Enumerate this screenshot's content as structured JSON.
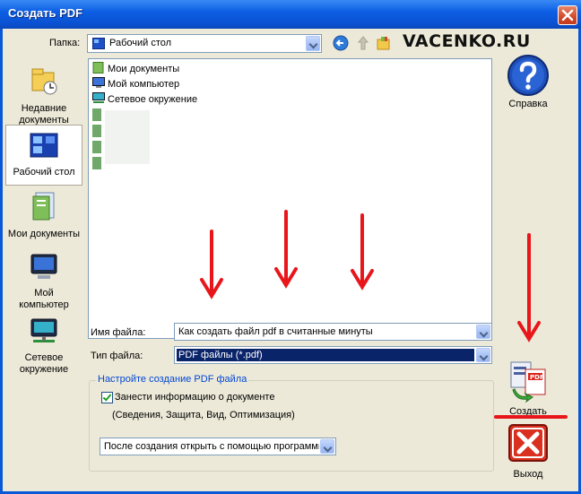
{
  "window": {
    "title": "Создать PDF"
  },
  "watermark": "VACENKO.RU",
  "folder": {
    "label": "Папка:",
    "value": "Рабочий стол"
  },
  "places": [
    {
      "label": "Недавние документы",
      "icon": "recent-documents-icon"
    },
    {
      "label": "Рабочий стол",
      "icon": "desktop-icon",
      "selected": true
    },
    {
      "label": "Мои документы",
      "icon": "my-documents-icon"
    },
    {
      "label": "Мой компьютер",
      "icon": "my-computer-icon"
    },
    {
      "label": "Сетевое окружение",
      "icon": "network-places-icon"
    }
  ],
  "files": [
    {
      "name": "Мои документы",
      "icon": "my-documents-icon"
    },
    {
      "name": "Мой компьютер",
      "icon": "my-computer-icon"
    },
    {
      "name": "Сетевое окружение",
      "icon": "network-places-icon"
    }
  ],
  "filename": {
    "label": "Имя файла:",
    "value": "Как создать файл pdf в считанные минуты"
  },
  "filetype": {
    "label": "Тип файла:",
    "value": "PDF файлы (*.pdf)"
  },
  "pdf_settings": {
    "title": "Настройте создание PDF файла",
    "include_info_label": "Занести информацию о документе",
    "include_info_checked": true,
    "include_info_details": "(Сведения, Защита, Вид, Оптимизация)",
    "after_create_value": "После создания открыть с помощью программы"
  },
  "buttons": {
    "help": "Справка",
    "create": "Создать",
    "exit": "Выход"
  },
  "colors": {
    "title_bar": "#0a57d8",
    "dialog_bg": "#ece9d8",
    "selection": "#0a246a",
    "annotation": "#e8161b"
  }
}
